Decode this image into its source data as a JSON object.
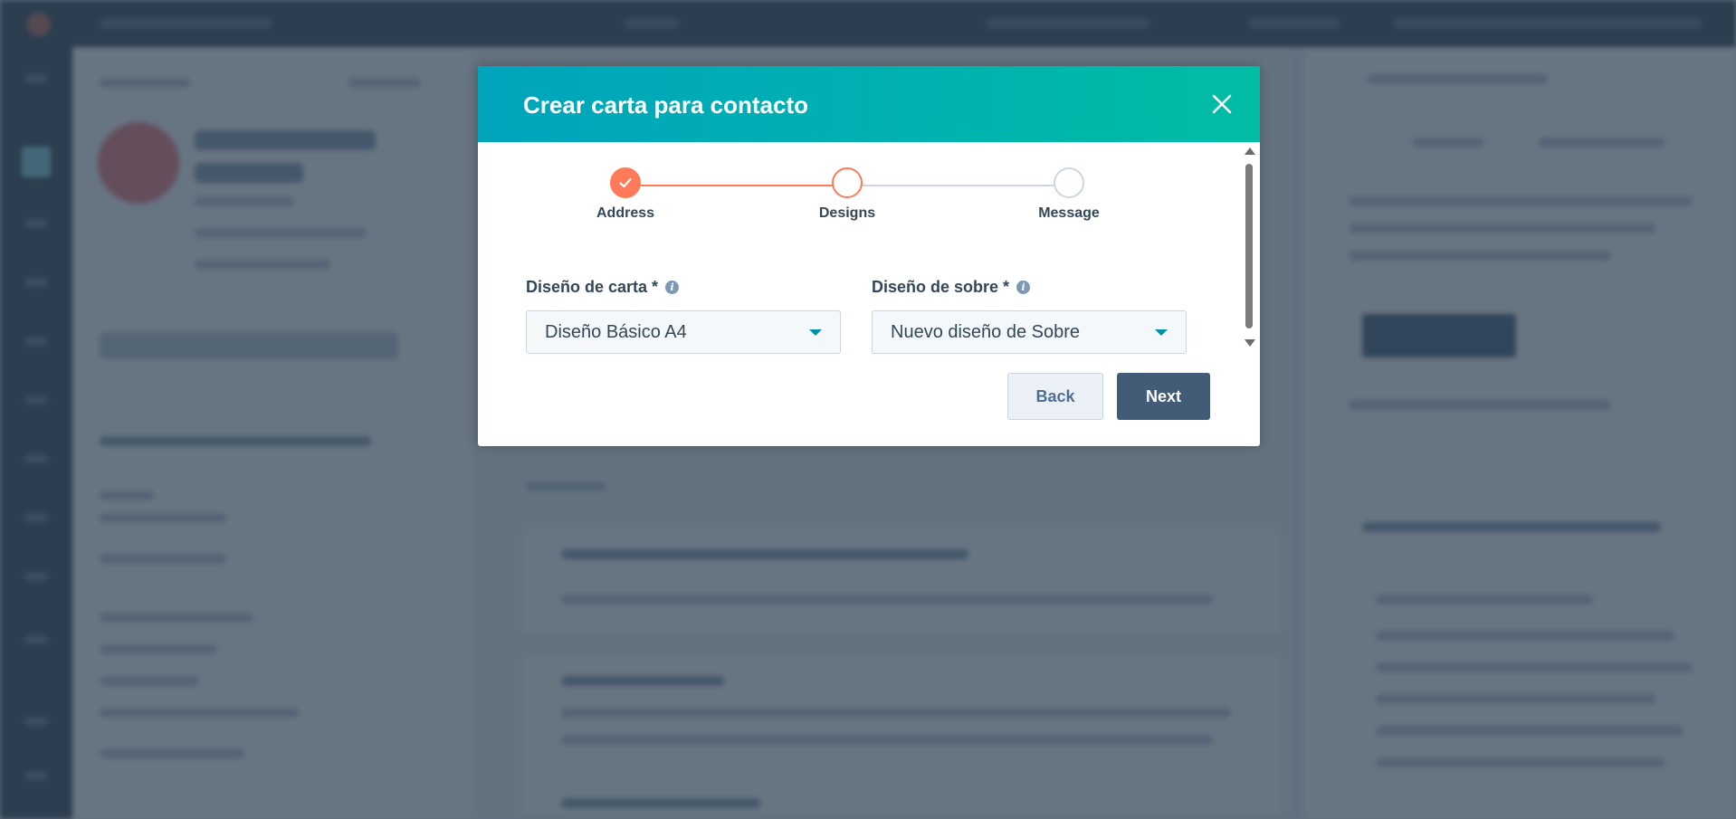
{
  "modal": {
    "title": "Crear carta para contacto",
    "close_icon": "close-icon",
    "steps": [
      {
        "label": "Address",
        "state": "done"
      },
      {
        "label": "Designs",
        "state": "active"
      },
      {
        "label": "Message",
        "state": "todo"
      }
    ],
    "letter_design": {
      "label": "Diseño de carta *",
      "value": "Diseño Básico A4"
    },
    "envelope_design": {
      "label": "Diseño de sobre *",
      "value": "Nuevo diseño de Sobre"
    },
    "back_label": "Back",
    "next_label": "Next"
  },
  "colors": {
    "header_start": "#00a4bd",
    "header_end": "#00bda5",
    "step_accent": "#ff7a59",
    "primary_button": "#425b76"
  }
}
